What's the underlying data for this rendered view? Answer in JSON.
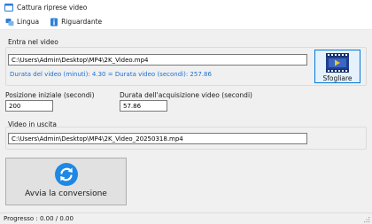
{
  "window": {
    "title": "Cattura riprese video"
  },
  "menu": {
    "language_label": "Lingua",
    "about_label": "Riguardante"
  },
  "input": {
    "group_label": "Entra nel video",
    "path_value": "C:\\Users\\Admin\\Desktop\\MP4\\2K_Video.mp4",
    "duration_label": "Durata del video (minuti):",
    "duration_minutes": "4.30",
    "duration_sep": "=",
    "duration_seconds_label": "Durata video (secondi):",
    "duration_seconds": "257.86",
    "browse_label": "Sfogliare"
  },
  "start": {
    "label": "Posizione iniziale (secondi)",
    "value": "200"
  },
  "capture": {
    "label": "Durata dell'acquisizione video (secondi)",
    "value": "57.86"
  },
  "output": {
    "group_label": "Video in uscita",
    "path_value": "C:\\Users\\Admin\\Desktop\\MP4\\2K_Video_20250318.mp4"
  },
  "convert": {
    "label": "Avvia la conversione"
  },
  "status": {
    "text": "Progresso : 0.00 / 0.00"
  },
  "colors": {
    "accent": "#0078d7",
    "info_text": "#1a6fd6",
    "panel_bg": "#f0f0f0"
  }
}
